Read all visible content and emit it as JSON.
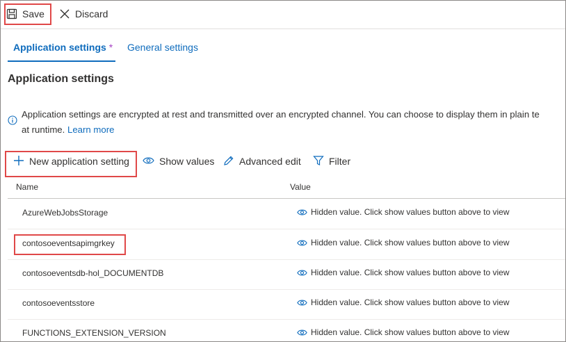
{
  "toolbar": {
    "save_label": "Save",
    "discard_label": "Discard"
  },
  "tabs": [
    {
      "label": "Application settings",
      "modified_marker": "*",
      "active": true
    },
    {
      "label": "General settings",
      "active": false
    }
  ],
  "section": {
    "title": "Application settings",
    "info_line1": "Application settings are encrypted at rest and transmitted over an encrypted channel. You can choose to display them in plain te",
    "info_line2_prefix": "at runtime.",
    "info_link": "Learn more"
  },
  "actions": {
    "new_setting": "New application setting",
    "show_values": "Show values",
    "advanced_edit": "Advanced edit",
    "filter": "Filter"
  },
  "grid": {
    "columns": [
      "Name",
      "Value"
    ],
    "rows": [
      {
        "name": "AzureWebJobsStorage",
        "value": "Hidden value. Click show values button above to view"
      },
      {
        "name": "contosoeventsapimgrkey",
        "value": "Hidden value. Click show values button above to view"
      },
      {
        "name": "contosoeventsdb-hol_DOCUMENTDB",
        "value": "Hidden value. Click show values button above to view"
      },
      {
        "name": "contosoeventsstore",
        "value": "Hidden value. Click show values button above to view"
      },
      {
        "name": "FUNCTIONS_EXTENSION_VERSION",
        "value": "Hidden value. Click show values button above to view"
      }
    ]
  },
  "colors": {
    "accent": "#0f6cbd",
    "highlight": "#e04848",
    "modified_star": "#a742c4"
  }
}
